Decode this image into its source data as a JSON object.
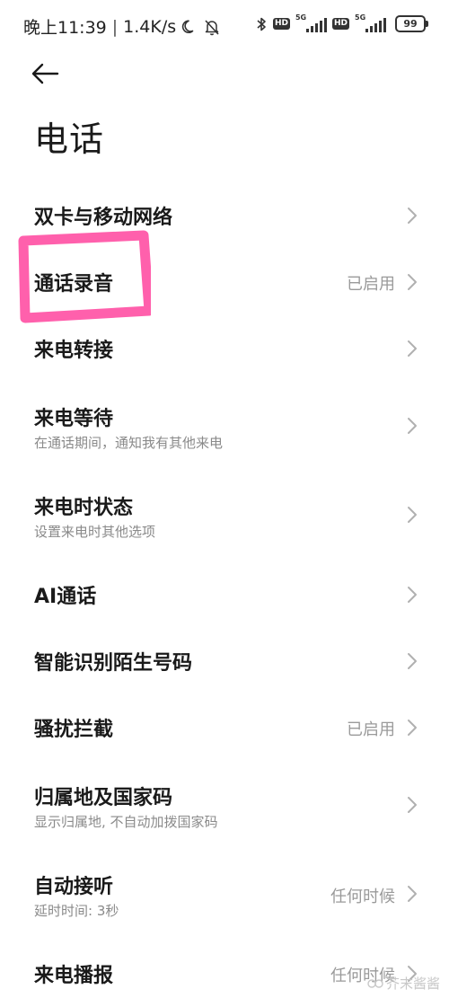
{
  "status_bar": {
    "time": "晚上11:39",
    "separator": "|",
    "network_speed": "1.4K/s",
    "icons_left": [
      "moon-icon",
      "muted-bell-icon"
    ],
    "icons_right": [
      "bluetooth-icon",
      "hd-badge",
      "signal-5g-icon",
      "hd-badge",
      "signal-5g-icon",
      "battery-icon"
    ],
    "hd_label": "HD",
    "fiveg_label": "5G",
    "battery_level": "99"
  },
  "header": {
    "back_icon": "back-arrow-icon",
    "title": "电话"
  },
  "settings": [
    {
      "label": "双卡与移动网络",
      "subtitle": "",
      "value": ""
    },
    {
      "label": "通话录音",
      "subtitle": "",
      "value": "已启用"
    },
    {
      "label": "来电转接",
      "subtitle": "",
      "value": ""
    },
    {
      "label": "来电等待",
      "subtitle": "在通话期间，通知我有其他来电",
      "value": ""
    },
    {
      "label": "来电时状态",
      "subtitle": "设置来电时其他选项",
      "value": ""
    },
    {
      "label": "AI通话",
      "subtitle": "",
      "value": ""
    },
    {
      "label": "智能识别陌生号码",
      "subtitle": "",
      "value": ""
    },
    {
      "label": "骚扰拦截",
      "subtitle": "",
      "value": "已启用"
    },
    {
      "label": "归属地及国家码",
      "subtitle": "显示归属地, 不自动加拨国家码",
      "value": ""
    },
    {
      "label": "自动接听",
      "subtitle": "延时时间: 3秒",
      "value": "任何时候"
    },
    {
      "label": "来电播报",
      "subtitle": "",
      "value": "任何时候"
    }
  ],
  "annotation": {
    "color": "#ff4fa3"
  },
  "watermark": {
    "text": "芥末酱酱"
  },
  "colors": {
    "text_primary": "#1a1a1a",
    "text_secondary": "#8a8a8a",
    "chevron": "#b0b0b0",
    "highlight": "#ff4fa3"
  }
}
